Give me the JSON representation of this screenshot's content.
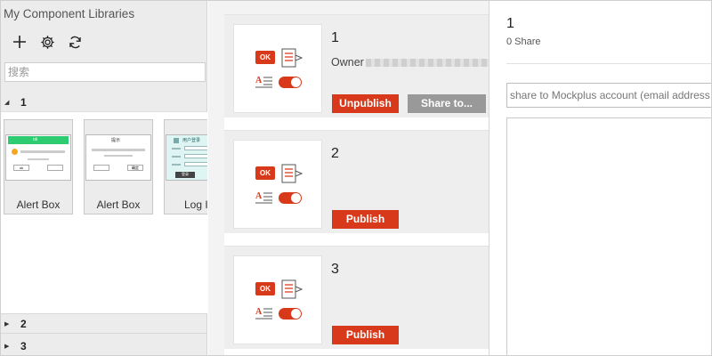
{
  "sidebar": {
    "title": "My Component Libraries",
    "tools": [
      {
        "icon": "plus-icon"
      },
      {
        "icon": "gear-icon"
      },
      {
        "icon": "refresh-icon"
      }
    ],
    "search_placeholder": "搜索",
    "groups": [
      {
        "name": "1",
        "expanded": true,
        "items": [
          {
            "name": "Alert Box",
            "thumb_lines": [
              "ok"
            ],
            "thumb_button": "ok"
          },
          {
            "name": "Alert Box",
            "thumb_lines": [
              "提示"
            ],
            "thumb_button": "确定"
          },
          {
            "name": "Log I",
            "thumb_lines": [
              "用户登录"
            ],
            "thumb_button": "登录"
          }
        ]
      },
      {
        "name": "2",
        "expanded": false
      },
      {
        "name": "3",
        "expanded": false
      }
    ]
  },
  "libraries": [
    {
      "name": "1",
      "owner_label": "Owner",
      "primary_button": "Unpublish",
      "secondary_button": "Share to..."
    },
    {
      "name": "2",
      "primary_button": "Publish"
    },
    {
      "name": "3",
      "primary_button": "Publish"
    }
  ],
  "share_panel": {
    "title": "1",
    "share_count": "0 Share",
    "input_placeholder": "share to Mockplus account (email address)"
  },
  "colors": {
    "accent": "#d8391a",
    "disabled_button": "#999999",
    "sidebar_bg": "#ececec"
  }
}
